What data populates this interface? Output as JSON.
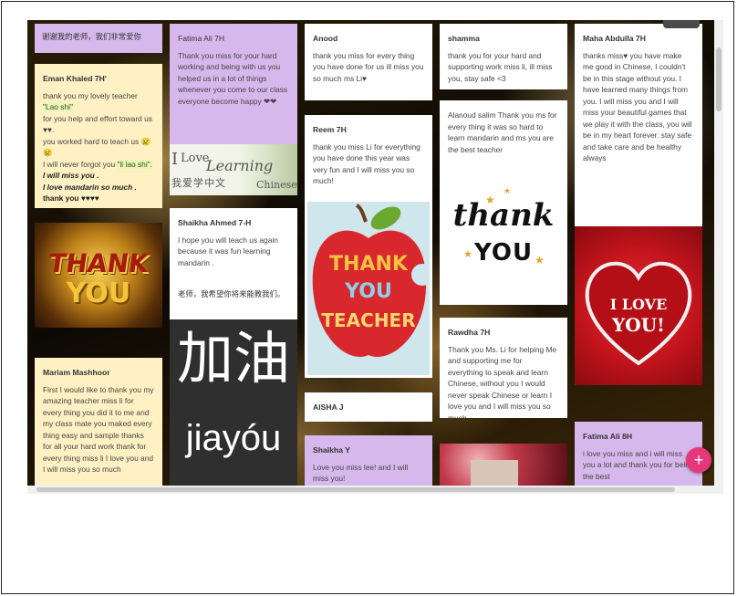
{
  "cards": {
    "banner": {
      "text": "谢谢我的老师，我们非常爱你"
    },
    "eman": {
      "title": "Eman Khaled 7H'",
      "l1": "thank you my lovely teacher",
      "l1b": "\"Lao shi\"",
      "l2": "for you help and effort toward us ♥♥.",
      "l3": "you worked hard to teach us 😢😢",
      "l4": "I will never forgot you",
      "l4b": "\"li lao shi\".",
      "l5": "I will miss you .",
      "l6": "I love mandarin so much .",
      "l7": "thank you ♥♥♥♥"
    },
    "fatima1": {
      "title": "Fatima Ali 7H",
      "body": "Thank you miss for your hard working and being with us you helped us in a lot of things whenever you come to our class everyone become happy ❤❤"
    },
    "anood": {
      "title": "Anood",
      "body": "thank you miss for every thing you have done for us ill miss you so much ms Li♥"
    },
    "shamma": {
      "title": "shamma",
      "body": "thank you for your hard and supporting work miss li, ill miss you, stay safe <3"
    },
    "maha": {
      "title": "Maha Abdulla 7H",
      "body": "thanks miss♥ you have make me good in Chinese, I couldn't be in this stage without you. I have learned many things from you. I will miss you and I will miss your beautiful games that we play it with the class, you will be in my heart forever. stay safe and take care and be healthy always"
    },
    "shaikha": {
      "title": "Shaikha Ahmed 7-H",
      "body": "I hope you will teach us again because it was fun learning mandarin .",
      "cn": "老师，我希望你将来能教我们。"
    },
    "reem": {
      "title": "Reem 7H",
      "body": "thank you miss Li for everything you have done this year was very fun and I will miss you so much!"
    },
    "alanoud": {
      "body": "Alanoud salim Thank you ms for every thing it was so hard to learn mandarin and ms you are the best teacher"
    },
    "mariam": {
      "title": "Mariam Mashhoor",
      "body": "First I would like to thank you my amazing teacher miss li for every thing you did it to me and my class mate you maked every thing easy and sample thanks for all your hard work thank for every thing miss li I love you and I will miss you so much"
    },
    "aisha": {
      "title": "AISHA J"
    },
    "shaikhaY": {
      "title": "Shaikha Y",
      "body": "Love you miss lee! and I will miss you!"
    },
    "rawdha": {
      "title": "Rawdha 7H",
      "body": "Thank you Ms. Li for helping Me and supporting me for everything to speak and learn Chinese, without you I would never speak Chinese or learn I love you and I will miss you so much."
    },
    "fatima2": {
      "title": "Fatima Ali 8H",
      "body": "i love you miss and i will miss you a lot and thank you for being the best"
    }
  },
  "images": {
    "thank3d": {
      "line1": "THANK",
      "line2": "YOU"
    },
    "learning": {
      "i": "I",
      "love": "Love",
      "learning": "Learning",
      "cn": "我爱学中文",
      "chinese": "Chinese"
    },
    "jiayou": {
      "cn": "加油",
      "pinyin": "jiayóu"
    },
    "apple": {
      "l1": "THANK",
      "l2": "YOU",
      "l3": "TEACHER"
    },
    "thankyou_script": {
      "l1": "thank",
      "l2": "YOU"
    },
    "heart": {
      "l1": "I LOVE",
      "l2": "YOU!"
    }
  },
  "fab": {
    "label": "+"
  }
}
